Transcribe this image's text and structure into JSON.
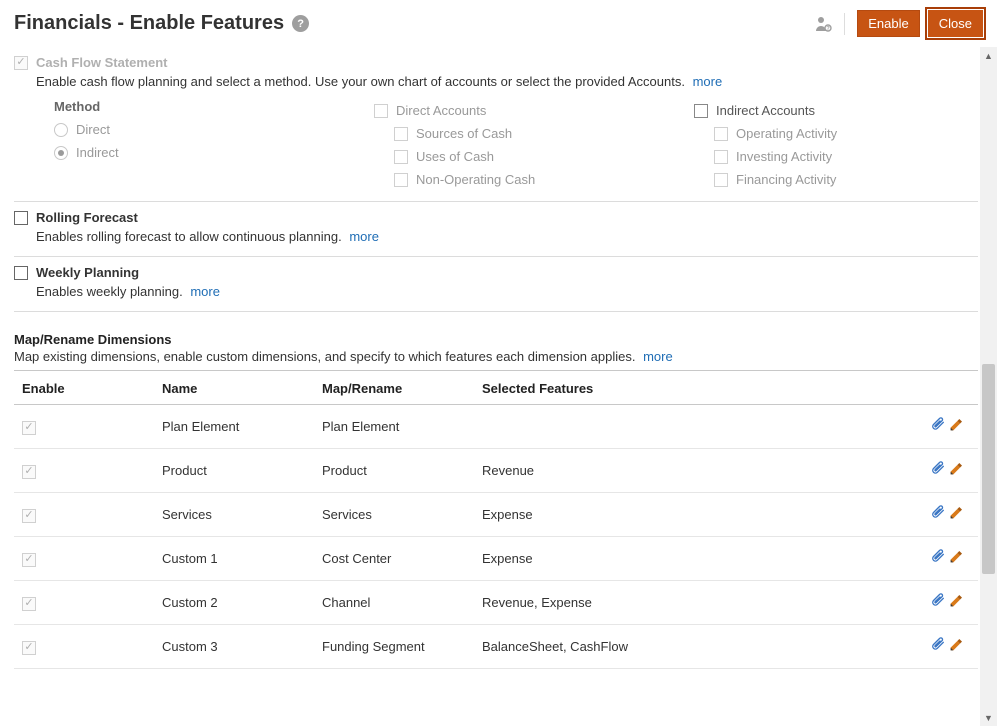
{
  "header": {
    "title": "Financials - Enable Features",
    "enable_btn": "Enable",
    "close_btn": "Close"
  },
  "cashflow": {
    "title": "Cash Flow Statement",
    "desc": "Enable cash flow planning and select a method. Use your own chart of accounts or select the provided Accounts.",
    "more": "more",
    "method_label": "Method",
    "direct": "Direct",
    "indirect": "Indirect",
    "direct_accounts": "Direct Accounts",
    "sources_of_cash": "Sources of Cash",
    "uses_of_cash": "Uses of Cash",
    "non_operating_cash": "Non-Operating Cash",
    "indirect_accounts": "Indirect Accounts",
    "operating_activity": "Operating Activity",
    "investing_activity": "Investing Activity",
    "financing_activity": "Financing Activity"
  },
  "rolling": {
    "title": "Rolling Forecast",
    "desc": "Enables rolling forecast to allow continuous planning.",
    "more": "more"
  },
  "weekly": {
    "title": "Weekly Planning",
    "desc": "Enables weekly planning.",
    "more": "more"
  },
  "map": {
    "title": "Map/Rename Dimensions",
    "desc": "Map existing dimensions, enable custom dimensions, and specify to which features each dimension applies.",
    "more": "more",
    "col_enable": "Enable",
    "col_name": "Name",
    "col_map": "Map/Rename",
    "col_features": "Selected Features",
    "rows": [
      {
        "name": "Plan Element",
        "map": "Plan Element",
        "features": ""
      },
      {
        "name": "Product",
        "map": "Product",
        "features": "Revenue"
      },
      {
        "name": "Services",
        "map": "Services",
        "features": "Expense"
      },
      {
        "name": "Custom 1",
        "map": "Cost Center",
        "features": "Expense"
      },
      {
        "name": "Custom 2",
        "map": "Channel",
        "features": "Revenue, Expense"
      },
      {
        "name": "Custom 3",
        "map": "Funding Segment",
        "features": "BalanceSheet, CashFlow"
      }
    ]
  }
}
